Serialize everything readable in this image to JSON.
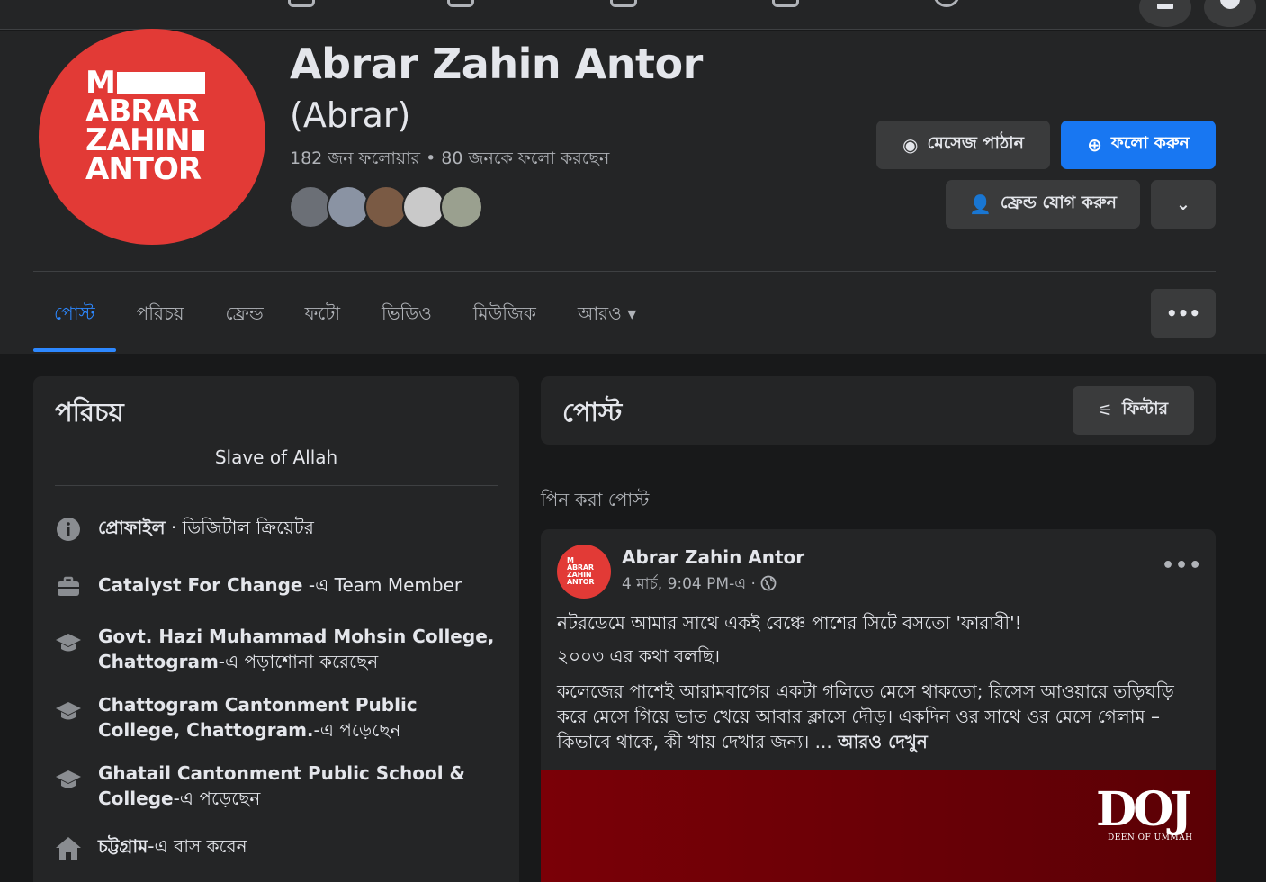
{
  "profile": {
    "name": "Abrar Zahin Antor",
    "alt_name": "(Abrar)",
    "follow_stats": "182 জন ফলোয়ার • 80 জনকে ফলো করছেন",
    "logo_lines": [
      "M",
      "ABRAR",
      "ZAHIN",
      "ANTOR"
    ],
    "friend_avatar_colors": [
      "#6b6f76",
      "#8a93a3",
      "#7a5a44",
      "#c9c9c9",
      "#9aa08f"
    ]
  },
  "actions": {
    "message": "মেসেজ পাঠান",
    "follow": "ফলো করুন",
    "add_friend": "ফ্রেন্ড যোগ করুন"
  },
  "tabs": [
    {
      "label": "পোস্ট"
    },
    {
      "label": "পরিচয়"
    },
    {
      "label": "ফ্রেন্ড"
    },
    {
      "label": "ফটো"
    },
    {
      "label": "ভিডিও"
    },
    {
      "label": "মিউজিক"
    },
    {
      "label": "আরও ▾"
    }
  ],
  "intro": {
    "title": "পরিচয়",
    "bio": "Slave of Allah",
    "items": [
      {
        "icon": "info-icon",
        "bold": "প্রোফাইল",
        "rest": " · ডিজিটাল ক্রিয়েটর"
      },
      {
        "icon": "briefcase-icon",
        "bold": "Catalyst For Change",
        "rest": " -এ Team Member"
      },
      {
        "icon": "graduation-cap-icon",
        "bold": "Govt. Hazi Muhammad Mohsin College, Chattogram",
        "rest": "-এ পড়াশোনা করেছেন"
      },
      {
        "icon": "graduation-cap-icon",
        "bold": "Chattogram Cantonment Public College, Chattogram.",
        "rest": "-এ পড়েছেন"
      },
      {
        "icon": "graduation-cap-icon",
        "bold": "Ghatail Cantonment Public School & College",
        "rest": "-এ পড়েছেন"
      },
      {
        "icon": "home-icon",
        "bold": "চট্টগ্রাম",
        "rest": "-এ বাস করেন"
      }
    ]
  },
  "posts": {
    "title": "পোস্ট",
    "filter": "ফিল্টার",
    "pinned_label": "পিন করা পোস্ট",
    "post": {
      "author": "Abrar Zahin Antor",
      "meta": "4 মার্চ, 9:04 PM-এ ·",
      "para1": "নটরডেমে আমার সাথে একই বেঞ্চে পাশের সিটে বসতো 'ফারাবী'!",
      "para2": "২০০৩ এর কথা বলছি।",
      "para3": "কলেজের পাশেই আরামবাগের একটা গলিতে মেসে থাকতো; রিসেস আওয়ারে তড়িঘড়ি করে মেসে গিয়ে ভাত খেয়ে আবার ক্লাসে দৌড়। একদিন ওর সাথে ওর মেসে গেলাম – কিভাবে থাকে, কী খায় দেখার জন্য। ...",
      "see_more": "আরও দেখুন",
      "image_logo": "DOJ",
      "image_sub": "DEEN OF UMMAH"
    }
  },
  "colors": {
    "accent": "#1877f2",
    "brand_red": "#e23a36",
    "background": "#18191a",
    "card": "#242526"
  }
}
